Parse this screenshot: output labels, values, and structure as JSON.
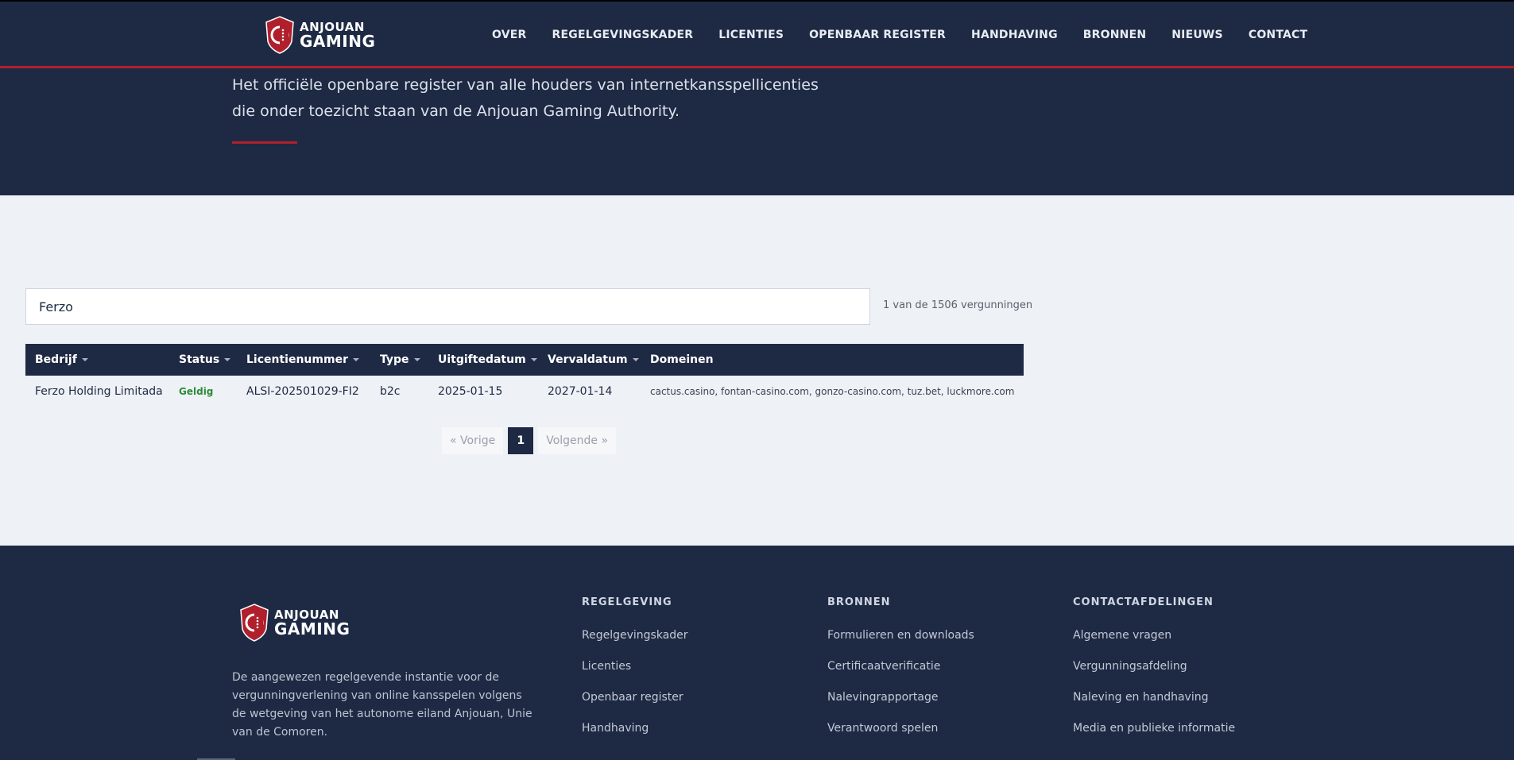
{
  "brand": {
    "line1": "ANJOUAN",
    "line2": "GAMING",
    "shield_color": "#b0202c"
  },
  "nav": {
    "items": [
      "OVER",
      "REGELGEVINGSKADER",
      "LICENTIES",
      "OPENBAAR REGISTER",
      "HANDHAVING",
      "BRONNEN",
      "NIEUWS",
      "CONTACT"
    ]
  },
  "hero": {
    "line1": "Het officiële openbare register van alle houders van internetkansspellicenties",
    "line2": "die onder toezicht staan van de Anjouan Gaming Authority."
  },
  "search": {
    "value": "Ferzo",
    "count_text": "1 van de 1506 vergunningen"
  },
  "table": {
    "headers": {
      "bedrijf": "Bedrijf",
      "status": "Status",
      "licentienummer": "Licentienummer",
      "type": "Type",
      "uitgiftedatum": "Uitgiftedatum",
      "vervaldatum": "Vervaldatum",
      "domeinen": "Domeinen"
    },
    "rows": [
      {
        "bedrijf": "Ferzo Holding Limitada",
        "status": "Geldig",
        "licentienummer": "ALSI-202501029-FI2",
        "type": "b2c",
        "uitgiftedatum": "2025-01-15",
        "vervaldatum": "2027-01-14",
        "domeinen": "cactus.casino, fontan-casino.com, gonzo-casino.com, tuz.bet, luckmore.com"
      }
    ]
  },
  "pagination": {
    "prev": "« Vorige",
    "current": "1",
    "next": "Volgende »"
  },
  "footer": {
    "description": "De aangewezen regelgevende instantie voor de vergunningverlening van online kansspelen volgens de wetgeving van het autonome eiland Anjouan, Unie van de Comoren.",
    "columns": [
      {
        "title": "REGELGEVING",
        "links": [
          "Regelgevingskader",
          "Licenties",
          "Openbaar register",
          "Handhaving"
        ]
      },
      {
        "title": "BRONNEN",
        "links": [
          "Formulieren en downloads",
          "Certificaatverificatie",
          "Nalevingrapportage",
          "Verantwoord spelen"
        ]
      },
      {
        "title": "CONTACTAFDELINGEN",
        "links": [
          "Algemene vragen",
          "Vergunningsafdeling",
          "Naleving en handhaving",
          "Media en publieke informatie"
        ]
      }
    ]
  },
  "colors": {
    "navy": "#1e2a44",
    "accent_red": "#b0202c",
    "status_green": "#2e8b3a"
  }
}
